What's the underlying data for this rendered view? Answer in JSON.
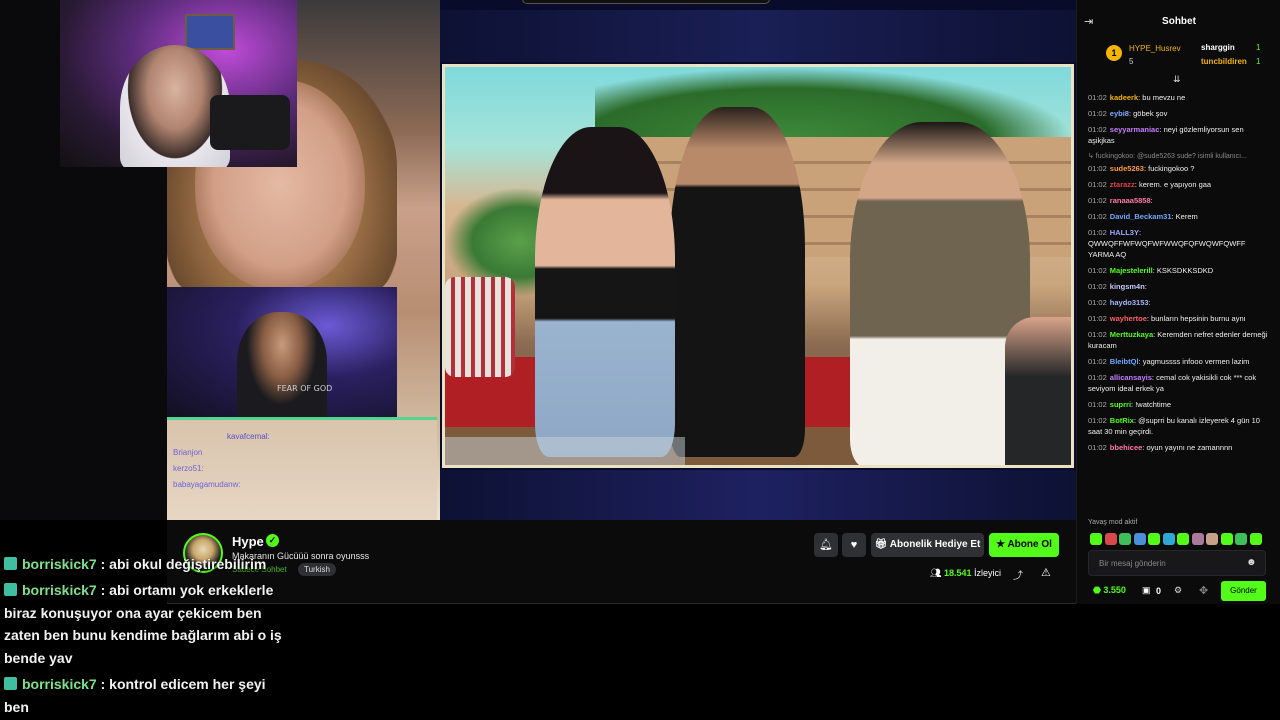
{
  "streamer": {
    "name": "Hype",
    "title": "Makaranın Gücüüü sonra oyunsss",
    "category": "Sadece Sohbet",
    "language": "Turkish",
    "viewers_count": "18.541",
    "viewers_label": "İzleyici"
  },
  "actions": {
    "gift_label": "Abonelik Hediye Et",
    "subscribe_label": "Abone Ol"
  },
  "overlay_chat": [
    {
      "user": "borriskick7",
      "text": " : abi okul değiştirebilirim"
    },
    {
      "user": "borriskick7",
      "text": " : abi ortamı yok erkeklerle biraz konuşuyor ona ayar çekicem ben zaten ben bunu kendime bağlarım abi o iş bende yav"
    },
    {
      "user": "borriskick7",
      "text": " : kontrol edicem her şeyi ben"
    }
  ],
  "overlay_mini": {
    "line1": "kavafcemal:",
    "line2": "Brianjon",
    "line3": "kerzo51:",
    "line4": "babayagamudanw:"
  },
  "guest_cam_text": "FEAR OF GOD",
  "chat": {
    "title": "Sohbet",
    "top_gifters": [
      {
        "name": "HYPE_Husrev",
        "count": "5"
      },
      {
        "name": "sharggin",
        "count": "1"
      },
      {
        "name": "tuncbildiren",
        "count": "1"
      }
    ],
    "messages": [
      {
        "time": "01:02",
        "user": "kadeerk",
        "color": "#f5b400",
        "text": ": bu mevzu ne"
      },
      {
        "time": "01:02",
        "user": "eybi8",
        "color": "#7fa8ff",
        "text": ": göbek şov"
      },
      {
        "time": "01:02",
        "user": "seyyarmaniac",
        "color": "#c77dff",
        "text": ": neyi gözlemliyorsun sen aşikjkas"
      },
      {
        "time": "",
        "user": "",
        "color": "#888",
        "text": "↳ fuckingokoo: @sude5263 sude? isimli kullanıcı...",
        "reply": true
      },
      {
        "time": "01:02",
        "user": "sude5263",
        "color": "#ff9a3c",
        "text": ": fuckingokoo ?"
      },
      {
        "time": "01:02",
        "user": "ztarazz",
        "color": "#e04040",
        "text": ": kerem. e yapıyon gaa"
      },
      {
        "time": "01:02",
        "user": "ranaaa5858",
        "color": "#ff7aa8",
        "text": ":"
      },
      {
        "time": "01:02",
        "user": "David_Beckam31",
        "color": "#6fa8ff",
        "text": ": Kerem"
      },
      {
        "time": "01:02",
        "user": "HALL3Y",
        "color": "#9aa8ff",
        "text": ": QWWQFFWFWQFWFWWQFQFWQWFQWFF YARMA AQ"
      },
      {
        "time": "01:02",
        "user": "Majestelerill",
        "color": "#53fc18",
        "text": ": KSKSDKKSDKD"
      },
      {
        "time": "01:02",
        "user": "kingsm4n",
        "color": "#c9c9ff",
        "text": ":"
      },
      {
        "time": "01:02",
        "user": "haydo3153",
        "color": "#a8b8ff",
        "text": ":"
      },
      {
        "time": "01:02",
        "user": "wayhertoe",
        "color": "#ff6060",
        "text": ": bunların hepsinin burnu aynı"
      },
      {
        "time": "01:02",
        "user": "Merttuzkaya",
        "color": "#53fc18",
        "text": ": Keremden nefret edenler derneği kuracam"
      },
      {
        "time": "01:02",
        "user": "BleibtQl",
        "color": "#6fa8ff",
        "text": ": yagmussss infooo vermen lazim"
      },
      {
        "time": "01:02",
        "user": "allicansayis",
        "color": "#c77dff",
        "text": ": cemal cok yakisikli cok *** cok seviyom ideal erkek ya"
      },
      {
        "time": "01:02",
        "user": "suprri",
        "color": "#53fc18",
        "text": ": !watchtime"
      },
      {
        "time": "01:02",
        "user": "BotRix",
        "color": "#53fc18",
        "text": ": @suprri bu kanalı izleyerek 4 gün 10 saat 30 min geçirdi."
      },
      {
        "time": "01:02",
        "user": "bbehicee",
        "color": "#ff7aa8",
        "text": ": oyun yayını ne zamannnn"
      }
    ],
    "slow_mode": "Yavaş mod aktif",
    "input_placeholder": "Bir mesaj gönderin",
    "points": "3.550",
    "drops": "0",
    "send_label": "Gönder"
  },
  "colors": {
    "accent": "#53fc18",
    "panel_bg": "#0b0b0c"
  }
}
